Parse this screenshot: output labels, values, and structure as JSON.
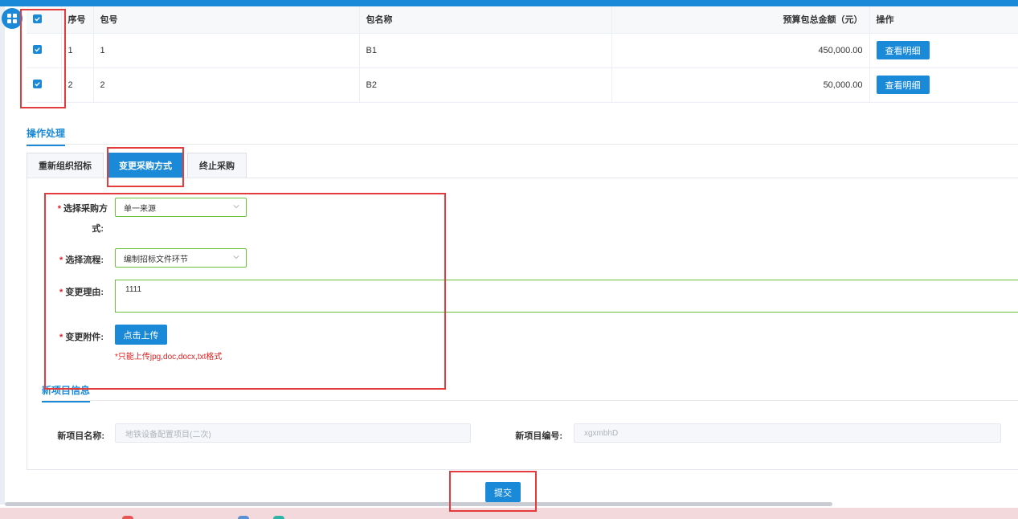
{
  "table": {
    "headers": {
      "seq": "序号",
      "pkg_no": "包号",
      "pkg_name": "包名称",
      "budget": "预算包总金额（元）",
      "action": "操作"
    },
    "rows": [
      {
        "seq": "1",
        "pkg_no": "1",
        "pkg_name": "B1",
        "budget": "450,000.00",
        "action_label": "查看明细",
        "checked": true
      },
      {
        "seq": "2",
        "pkg_no": "2",
        "pkg_name": "B2",
        "budget": "50,000.00",
        "action_label": "查看明细",
        "checked": true
      }
    ]
  },
  "section": {
    "title": "操作处理"
  },
  "tabs": [
    {
      "label": "重新组织招标",
      "active": false
    },
    {
      "label": "变更采购方式",
      "active": true
    },
    {
      "label": "终止采购",
      "active": false
    }
  ],
  "form": {
    "purchase_method": {
      "label_line1": "选择采购方",
      "label_line2": "式:",
      "value": "单一来源"
    },
    "flow": {
      "label": "选择流程:",
      "value": "编制招标文件环节"
    },
    "reason": {
      "label": "变更理由:",
      "value": "1111"
    },
    "attachment": {
      "label": "变更附件:",
      "button": "点击上传",
      "hint": "*只能上传jpg,doc,docx,txt格式"
    },
    "required_mark": "*"
  },
  "new_project": {
    "title": "新项目信息",
    "name_label": "新项目名称:",
    "name_value": "地铁设备配置项目(二次)",
    "code_label": "新项目编号:",
    "code_value": "xgxmbhD"
  },
  "submit_label": "提交",
  "colors": {
    "primary": "#1a8ad8",
    "required": "#e02020",
    "valid_border": "#67c23a",
    "annotation": "#e43c3c"
  }
}
